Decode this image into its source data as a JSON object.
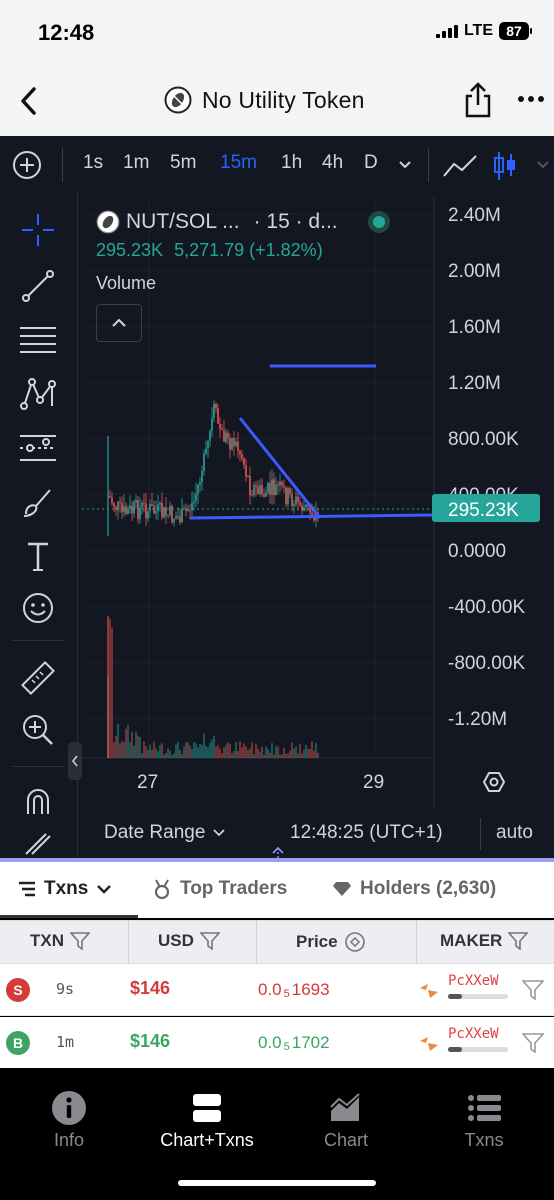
{
  "status": {
    "time": "12:48",
    "network": "LTE",
    "battery": "87"
  },
  "nav": {
    "title": "No Utility Token"
  },
  "toolbar": {
    "intervals": [
      "1s",
      "1m",
      "5m",
      "15m",
      "1h",
      "4h",
      "D"
    ],
    "active_interval": "15m"
  },
  "chart": {
    "symbol": "NUT/SOL ...",
    "interval_suffix": "· 15 · d...",
    "last_price": "295.23K",
    "change": "5,271.79 (+1.82%)",
    "indicator": "Volume",
    "price_tag": "295.23K",
    "colors": {
      "up": "#26a69a",
      "down": "#ef5350",
      "drawing": "#3d5afe",
      "tag": "#26a69a"
    }
  },
  "chart_data": {
    "type": "candlestick",
    "y_axis_ticks": [
      "2.40M",
      "2.00M",
      "1.60M",
      "1.20M",
      "800.00K",
      "400.00K",
      "0.0000",
      "-400.00K",
      "-800.00K",
      "-1.20M"
    ],
    "x_axis_ticks": [
      "27",
      "29"
    ],
    "ylim": [
      -1400000,
      2560000
    ],
    "last_value": 295230,
    "grid": true
  },
  "footer": {
    "date_range": "Date Range",
    "clock": "12:48:25 (UTC+1)",
    "auto": "auto"
  },
  "tabs": {
    "txns": "Txns",
    "top_traders": "Top Traders",
    "holders": "Holders (2,630)"
  },
  "table": {
    "headers": {
      "txn": "TXN",
      "usd": "USD",
      "price": "Price",
      "maker": "MAKER"
    },
    "rows": [
      {
        "type": "S",
        "age": "9s",
        "usd": "$146",
        "price_prefix": "0.0",
        "price_zeros": "5",
        "price_rest": "1693",
        "maker": "PcXXeW",
        "color": "#d43b3b"
      },
      {
        "type": "B",
        "age": "1m",
        "usd": "$146",
        "price_prefix": "0.0",
        "price_zeros": "5",
        "price_rest": "1702",
        "maker": "PcXXeW",
        "color": "#3fa463"
      }
    ]
  },
  "bottom_nav": [
    {
      "label": "Info",
      "icon": "info-icon"
    },
    {
      "label": "Chart+Txns",
      "icon": "chart-txns-icon",
      "active": true
    },
    {
      "label": "Chart",
      "icon": "chart-icon"
    },
    {
      "label": "Txns",
      "icon": "list-icon"
    }
  ]
}
